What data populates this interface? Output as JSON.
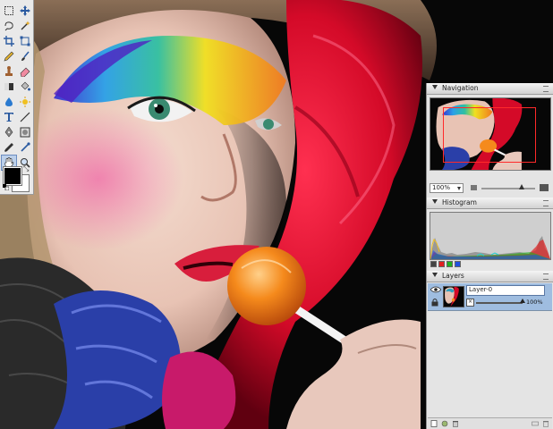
{
  "tools": {
    "items": [
      {
        "name": "marquee-tool-icon",
        "glyph": "rect"
      },
      {
        "name": "move-tool-icon",
        "glyph": "move"
      },
      {
        "name": "lasso-tool-icon",
        "glyph": "lasso"
      },
      {
        "name": "magic-wand-tool-icon",
        "glyph": "wand"
      },
      {
        "name": "crop-tool-icon",
        "glyph": "crop"
      },
      {
        "name": "transform-tool-icon",
        "glyph": "xform"
      },
      {
        "name": "pencil-tool-icon",
        "glyph": "pencil"
      },
      {
        "name": "brush-tool-icon",
        "glyph": "brush"
      },
      {
        "name": "stamp-tool-icon",
        "glyph": "stamp"
      },
      {
        "name": "eraser-tool-icon",
        "glyph": "eraser"
      },
      {
        "name": "gradient-tool-icon",
        "glyph": "gradient"
      },
      {
        "name": "paint-bucket-tool-icon",
        "glyph": "bucket"
      },
      {
        "name": "blur-tool-icon",
        "glyph": "drop"
      },
      {
        "name": "dodge-tool-icon",
        "glyph": "sun"
      },
      {
        "name": "type-tool-icon",
        "glyph": "type"
      },
      {
        "name": "line-tool-icon",
        "glyph": "line"
      },
      {
        "name": "pen-tool-icon",
        "glyph": "pen"
      },
      {
        "name": "shape-tool-icon",
        "glyph": "shape"
      },
      {
        "name": "eyedropper-tool-icon",
        "glyph": "dropper"
      },
      {
        "name": "color-replace-tool-icon",
        "glyph": "replace"
      },
      {
        "name": "hand-tool-icon",
        "glyph": "hand",
        "active": true
      },
      {
        "name": "zoom-tool-icon",
        "glyph": "zoom"
      }
    ],
    "foreground_color": "#000000",
    "background_color": "#ffffff"
  },
  "navigation": {
    "title": "Navigation",
    "zoom": "100%",
    "zoom_slider_fraction": 0.75
  },
  "histogram": {
    "title": "Histogram",
    "channel_colors": [
      "#444444",
      "#e02020",
      "#20b020",
      "#2050e0"
    ]
  },
  "layers": {
    "title": "Layers",
    "layer_name": "Layer-0",
    "opacity": "100%",
    "opacity_fraction": 1.0,
    "mask_symbol": "×",
    "selection_color": "#9fbde0"
  }
}
